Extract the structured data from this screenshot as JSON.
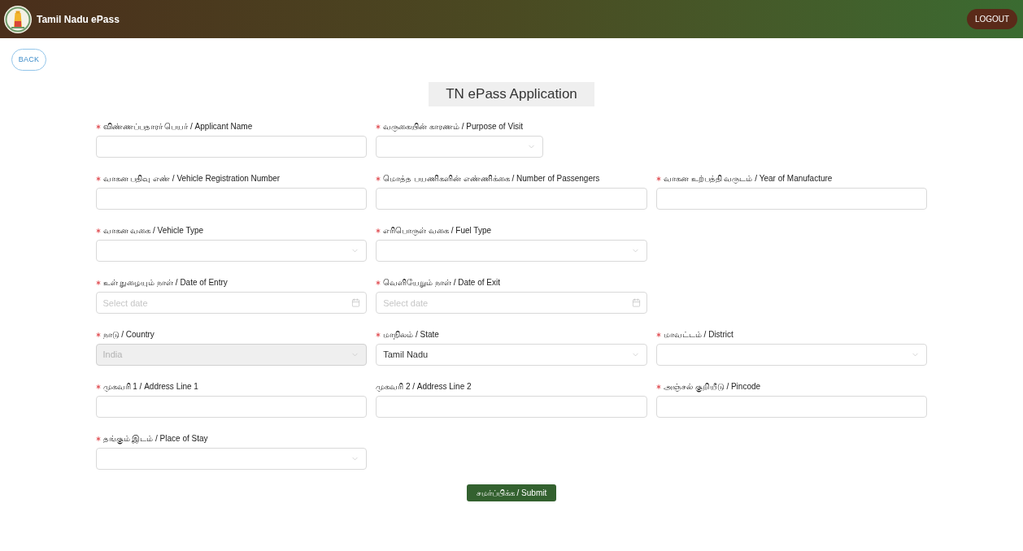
{
  "header": {
    "title": "Tamil Nadu ePass",
    "logout_button": "LOGOUT"
  },
  "back_button": "BACK",
  "form": {
    "title": "TN ePass Application",
    "rows": [
      {
        "fields": [
          {
            "kind": "text",
            "label": "விண்ணப்பதாரர் பெயர் / Applicant Name",
            "required": true,
            "disabled": false,
            "compact": false
          },
          {
            "kind": "select",
            "label": "வருகையின் காரணம் / Purpose of Visit",
            "required": true,
            "disabled": false,
            "compact": true
          }
        ]
      },
      {
        "fields": [
          {
            "kind": "text",
            "label": "வாகன பதிவு எண் / Vehicle Registration Number",
            "required": true,
            "disabled": false,
            "compact": false
          },
          {
            "kind": "text",
            "label": "மொத்த பயணிகளின் எண்ணிக்கை / Number of Passengers",
            "required": true,
            "disabled": false,
            "compact": false
          },
          {
            "kind": "text",
            "label": "வாகன உற்பத்தி வருடம் / Year of Manufacture",
            "required": true,
            "disabled": false,
            "compact": false
          }
        ]
      },
      {
        "fields": [
          {
            "kind": "select",
            "label": "வாகன வகை / Vehicle Type",
            "required": true,
            "disabled": false,
            "compact": false
          },
          {
            "kind": "select",
            "label": "எரிபொருள் வகை / Fuel Type",
            "required": true,
            "disabled": false,
            "compact": false
          }
        ]
      },
      {
        "fields": [
          {
            "kind": "date",
            "label": "உள் நுழையும் நாள் / Date of Entry",
            "placeholder": "Select date",
            "required": true,
            "disabled": false,
            "compact": false
          },
          {
            "kind": "date",
            "label": "வெளியேறும் நாள் / Date of Exit",
            "placeholder": "Select date",
            "required": true,
            "disabled": false,
            "compact": false
          }
        ]
      },
      {
        "fields": [
          {
            "kind": "select",
            "label": "நாடு / Country",
            "value": "India",
            "required": true,
            "disabled": true,
            "compact": false
          },
          {
            "kind": "select",
            "label": "மாநிலம் / State",
            "value": "Tamil Nadu",
            "required": true,
            "disabled": false,
            "compact": false
          },
          {
            "kind": "select",
            "label": "மாவட்டம் / District",
            "required": true,
            "disabled": false,
            "compact": false
          }
        ]
      },
      {
        "fields": [
          {
            "kind": "text",
            "label": "முகவரி 1 / Address Line 1",
            "required": true,
            "disabled": false,
            "compact": false
          },
          {
            "kind": "text",
            "label": "முகவரி 2 / Address Line 2",
            "required": false,
            "disabled": false,
            "compact": false
          },
          {
            "kind": "text",
            "label": "அஞ்சல் குறியீடு / Pincode",
            "required": true,
            "disabled": false,
            "compact": false
          }
        ]
      },
      {
        "fields": [
          {
            "kind": "select",
            "label": "தங்கும் இடம் / Place of Stay",
            "required": true,
            "disabled": false,
            "compact": false
          }
        ]
      }
    ],
    "submit_button": "சமர்ப்பிக்க / Submit"
  }
}
